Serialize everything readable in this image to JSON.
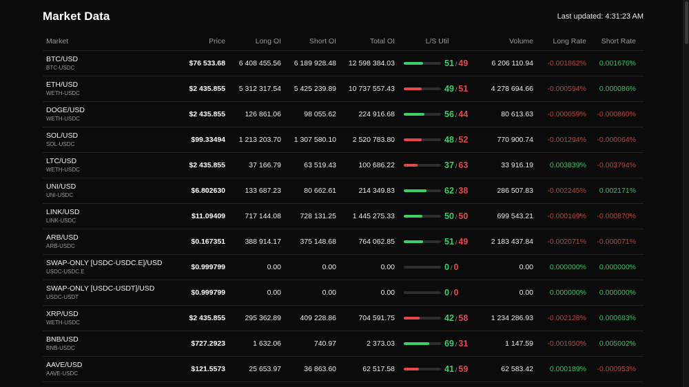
{
  "header": {
    "title": "Market Data",
    "last_updated": "Last updated: 4:31:23 AM"
  },
  "colors": {
    "background": "#0b0b0b",
    "positive": "#3ecf6a",
    "negative": "#e5484d",
    "negative_rate": "#b8473f"
  },
  "columns": {
    "market": "Market",
    "price": "Price",
    "long_oi": "Long OI",
    "short_oi": "Short OI",
    "total_oi": "Total OI",
    "ls_util": "L/S Util",
    "volume": "Volume",
    "long_rate": "Long Rate",
    "short_rate": "Short Rate"
  },
  "rows": [
    {
      "market": "BTC/USD",
      "sub": "BTC-USDC",
      "price": "$76 533.68",
      "long_oi": "6 408 455.56",
      "short_oi": "6 189 928.48",
      "total_oi": "12 598 384.03",
      "util_long": "51",
      "util_short": "49",
      "util_sep": "/",
      "util_fill": 0.51,
      "volume": "6 206 110.94",
      "long_rate": "-0.001862%",
      "short_rate": "0.001676%"
    },
    {
      "market": "ETH/USD",
      "sub": "WETH-USDC",
      "price": "$2 435.855",
      "long_oi": "5 312 317.54",
      "short_oi": "5 425 239.89",
      "total_oi": "10 737 557.43",
      "util_long": "49",
      "util_short": "51",
      "util_sep": "/",
      "util_fill": 0.49,
      "volume": "4 278 694.66",
      "long_rate": "-0.000594%",
      "short_rate": "0.000086%"
    },
    {
      "market": "DOGE/USD",
      "sub": "WETH-USDC",
      "price": "$2 435.855",
      "long_oi": "126 861.06",
      "short_oi": "98 055.62",
      "total_oi": "224 916.68",
      "util_long": "56",
      "util_short": "44",
      "util_sep": "/",
      "util_fill": 0.56,
      "volume": "80 613.63",
      "long_rate": "-0.000059%",
      "short_rate": "-0.000860%"
    },
    {
      "market": "SOL/USD",
      "sub": "SOL-USDC",
      "price": "$99.33494",
      "long_oi": "1 213 203.70",
      "short_oi": "1 307 580.10",
      "total_oi": "2 520 783.80",
      "util_long": "48",
      "util_short": "52",
      "util_sep": "/",
      "util_fill": 0.48,
      "volume": "770 900.74",
      "long_rate": "-0.001294%",
      "short_rate": "-0.000064%"
    },
    {
      "market": "LTC/USD",
      "sub": "WETH-USDC",
      "price": "$2 435.855",
      "long_oi": "37 166.79",
      "short_oi": "63 519.43",
      "total_oi": "100 686.22",
      "util_long": "37",
      "util_short": "63",
      "util_sep": "/",
      "util_fill": 0.37,
      "volume": "33 916.19",
      "long_rate": "0.003839%",
      "short_rate": "-0.003794%"
    },
    {
      "market": "UNI/USD",
      "sub": "UNI-USDC",
      "price": "$6.802630",
      "long_oi": "133 687.23",
      "short_oi": "80 662.61",
      "total_oi": "214 349.83",
      "util_long": "62",
      "util_short": "38",
      "util_sep": "/",
      "util_fill": 0.62,
      "volume": "286 507.83",
      "long_rate": "-0.002245%",
      "short_rate": "0.002171%"
    },
    {
      "market": "LINK/USD",
      "sub": "LINK-USDC",
      "price": "$11.09409",
      "long_oi": "717 144.08",
      "short_oi": "728 131.25",
      "total_oi": "1 445 275.33",
      "util_long": "50",
      "util_short": "50",
      "util_sep": "/",
      "util_fill": 0.5,
      "volume": "699 543.21",
      "long_rate": "-0.000169%",
      "short_rate": "-0.000870%"
    },
    {
      "market": "ARB/USD",
      "sub": "ARB-USDC",
      "price": "$0.167351",
      "long_oi": "388 914.17",
      "short_oi": "375 148.68",
      "total_oi": "764 062.85",
      "util_long": "51",
      "util_short": "49",
      "util_sep": "/",
      "util_fill": 0.51,
      "volume": "2 183 437.84",
      "long_rate": "-0.002071%",
      "short_rate": "-0.000071%"
    },
    {
      "market": "SWAP-ONLY [USDC-USDC.E]/USD",
      "sub": "USDC-USDC.E",
      "price": "$0.999799",
      "long_oi": "0.00",
      "short_oi": "0.00",
      "total_oi": "0.00",
      "util_long": "0",
      "util_short": "0",
      "util_sep": "/",
      "util_fill": 0,
      "volume": "0.00",
      "long_rate": "0.000000%",
      "short_rate": "0.000000%"
    },
    {
      "market": "SWAP-ONLY [USDC-USDT]/USD",
      "sub": "USDC-USDT",
      "price": "$0.999799",
      "long_oi": "0.00",
      "short_oi": "0.00",
      "total_oi": "0.00",
      "util_long": "0",
      "util_short": "0",
      "util_sep": "/",
      "util_fill": 0,
      "volume": "0.00",
      "long_rate": "0.000000%",
      "short_rate": "0.000000%"
    },
    {
      "market": "XRP/USD",
      "sub": "WETH-USDC",
      "price": "$2 435.855",
      "long_oi": "295 362.89",
      "short_oi": "409 228.86",
      "total_oi": "704 591.75",
      "util_long": "42",
      "util_short": "58",
      "util_sep": "/",
      "util_fill": 0.42,
      "volume": "1 234 286.93",
      "long_rate": "-0.002128%",
      "short_rate": "0.000683%"
    },
    {
      "market": "BNB/USD",
      "sub": "BNB-USDC",
      "price": "$727.2923",
      "long_oi": "1 632.06",
      "short_oi": "740.97",
      "total_oi": "2 373.03",
      "util_long": "69",
      "util_short": "31",
      "util_sep": "/",
      "util_fill": 0.69,
      "volume": "1 147.59",
      "long_rate": "-0.001950%",
      "short_rate": "0.005002%"
    },
    {
      "market": "AAVE/USD",
      "sub": "AAVE-USDC",
      "price": "$121.5573",
      "long_oi": "25 653.97",
      "short_oi": "36 863.60",
      "total_oi": "62 517.58",
      "util_long": "41",
      "util_short": "59",
      "util_sep": "/",
      "util_fill": 0.41,
      "volume": "62 583.42",
      "long_rate": "0.000189%",
      "short_rate": "-0.000953%"
    }
  ]
}
